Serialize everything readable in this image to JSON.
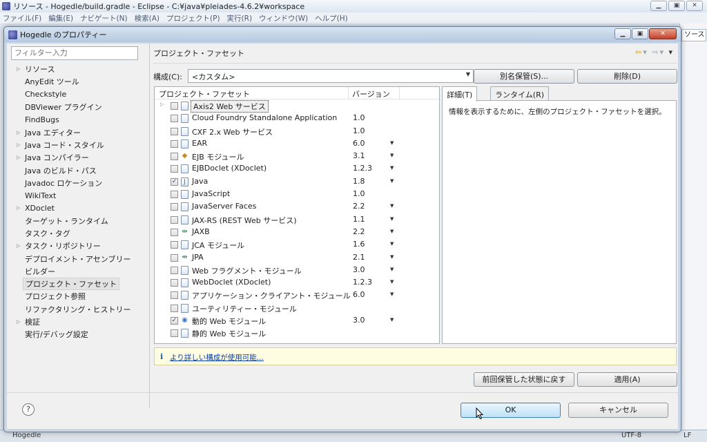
{
  "eclipse": {
    "title": "リソース - Hogedle/build.gradle - Eclipse - C:¥java¥pleiades-4.6.2¥workspace",
    "menu": [
      "ファイル(F)",
      "編集(E)",
      "ナビゲート(N)",
      "検索(A)",
      "プロジェクト(P)",
      "実行(R)",
      "ウィンドウ(W)",
      "ヘルプ(H)"
    ],
    "right_tab": "ソース",
    "status_left": "Hogedle",
    "status_encoding": "UTF-8",
    "status_lf": "LF"
  },
  "dialog": {
    "title": "Hogedle のプロパティー",
    "filter_placeholder": "フィルター入力",
    "tree": [
      {
        "label": "リソース",
        "expandable": true
      },
      {
        "label": "AnyEdit ツール",
        "expandable": false
      },
      {
        "label": "Checkstyle",
        "expandable": false
      },
      {
        "label": "DBViewer プラグイン",
        "expandable": false
      },
      {
        "label": "FindBugs",
        "expandable": false
      },
      {
        "label": "Java エディター",
        "expandable": true
      },
      {
        "label": "Java コード・スタイル",
        "expandable": true
      },
      {
        "label": "Java コンパイラー",
        "expandable": true
      },
      {
        "label": "Java のビルド・パス",
        "expandable": false
      },
      {
        "label": "Javadoc ロケーション",
        "expandable": false
      },
      {
        "label": "WikiText",
        "expandable": false
      },
      {
        "label": "XDoclet",
        "expandable": true
      },
      {
        "label": "ターゲット・ランタイム",
        "expandable": false
      },
      {
        "label": "タスク・タグ",
        "expandable": false
      },
      {
        "label": "タスク・リポジトリー",
        "expandable": true
      },
      {
        "label": "デプロイメント・アセンブリー",
        "expandable": false
      },
      {
        "label": "ビルダー",
        "expandable": false
      },
      {
        "label": "プロジェクト・ファセット",
        "expandable": false,
        "selected": true
      },
      {
        "label": "プロジェクト参照",
        "expandable": false
      },
      {
        "label": "リファクタリング・ヒストリー",
        "expandable": false
      },
      {
        "label": "検証",
        "expandable": true
      },
      {
        "label": "実行/デバッグ設定",
        "expandable": false
      }
    ],
    "page_title": "プロジェクト・ファセット",
    "config_label": "構成(C):",
    "config_value": "<カスタム>",
    "save_as_button": "別名保管(S)...",
    "delete_button": "削除(D)",
    "table_headers": {
      "facet": "プロジェクト・ファセット",
      "version": "バージョン"
    },
    "facets": [
      {
        "name": "Axis2 Web サービス",
        "version": "",
        "checked": false,
        "expandable": true,
        "dropdown": false,
        "icon": "document-icon",
        "focused": true
      },
      {
        "name": "Cloud Foundry Standalone Application",
        "version": "1.0",
        "checked": false,
        "dropdown": false,
        "icon": "document-icon"
      },
      {
        "name": "CXF 2.x Web サービス",
        "version": "1.0",
        "checked": false,
        "dropdown": false,
        "icon": "document-icon"
      },
      {
        "name": "EAR",
        "version": "6.0",
        "checked": false,
        "dropdown": true,
        "icon": "document-icon"
      },
      {
        "name": "EJB モジュール",
        "version": "3.1",
        "checked": false,
        "dropdown": true,
        "icon": "ejb-icon"
      },
      {
        "name": "EJBDoclet (XDoclet)",
        "version": "1.2.3",
        "checked": false,
        "dropdown": true,
        "icon": "document-icon"
      },
      {
        "name": "Java",
        "version": "1.8",
        "checked": true,
        "dropdown": true,
        "icon": "java-icon"
      },
      {
        "name": "JavaScript",
        "version": "1.0",
        "checked": false,
        "dropdown": false,
        "icon": "document-icon"
      },
      {
        "name": "JavaServer Faces",
        "version": "2.2",
        "checked": false,
        "dropdown": true,
        "icon": "document-icon"
      },
      {
        "name": "JAX-RS (REST Web サービス)",
        "version": "1.1",
        "checked": false,
        "dropdown": true,
        "icon": "document-icon"
      },
      {
        "name": "JAXB",
        "version": "2.2",
        "checked": false,
        "dropdown": true,
        "icon": "jaxb-icon"
      },
      {
        "name": "JCA モジュール",
        "version": "1.6",
        "checked": false,
        "dropdown": true,
        "icon": "document-icon"
      },
      {
        "name": "JPA",
        "version": "2.1",
        "checked": false,
        "dropdown": true,
        "icon": "jpa-icon"
      },
      {
        "name": "Web フラグメント・モジュール",
        "version": "3.0",
        "checked": false,
        "dropdown": true,
        "icon": "document-icon"
      },
      {
        "name": "WebDoclet (XDoclet)",
        "version": "1.2.3",
        "checked": false,
        "dropdown": true,
        "icon": "document-icon"
      },
      {
        "name": "アプリケーション・クライアント・モジュール",
        "version": "6.0",
        "checked": false,
        "dropdown": true,
        "icon": "document-icon"
      },
      {
        "name": "ユーティリティー・モジュール",
        "version": "",
        "checked": false,
        "dropdown": false,
        "icon": "document-icon"
      },
      {
        "name": "動的 Web モジュール",
        "version": "3.0",
        "checked": true,
        "dropdown": true,
        "icon": "web-icon"
      },
      {
        "name": "静的 Web モジュール",
        "version": "",
        "checked": false,
        "dropdown": false,
        "icon": "document-icon"
      }
    ],
    "detail_tabs": [
      "詳細(T)",
      "ランタイム(R)"
    ],
    "detail_message": "情報を表示するために、左側のプロジェクト・ファセットを選択。",
    "info_link": "より詳しい構成が使用可能...",
    "restore_button": "前回保管した状態に戻す",
    "apply_button": "適用(A)",
    "ok_button": "OK",
    "cancel_button": "キャンセル",
    "help_symbol": "?"
  }
}
